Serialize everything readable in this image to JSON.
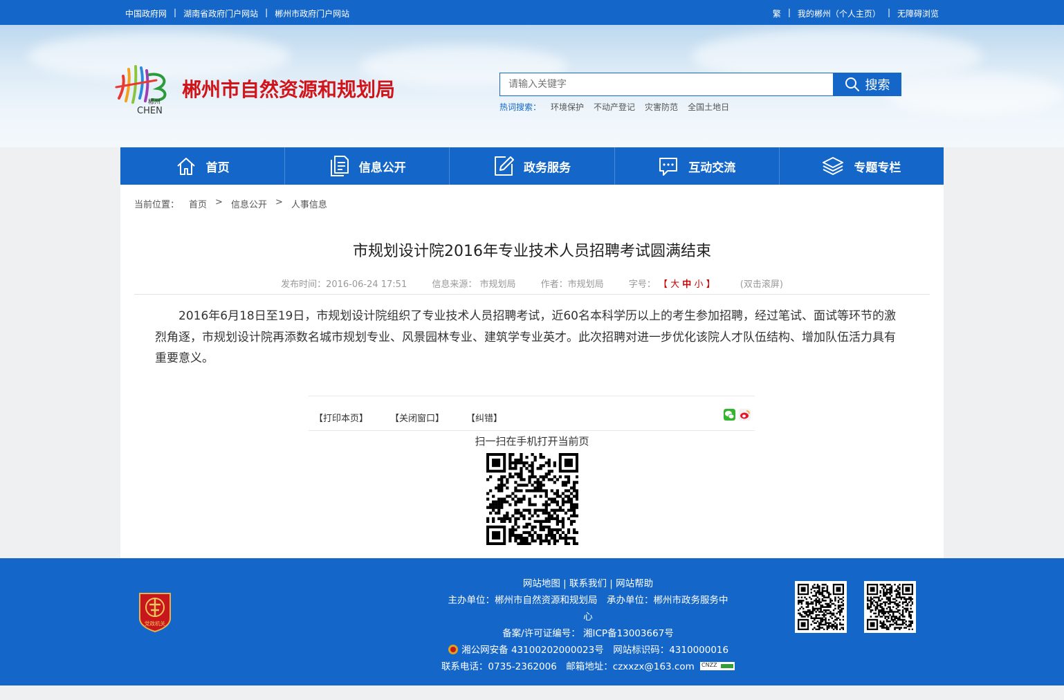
{
  "topbar": {
    "left_links": [
      "中国政府网",
      "湖南省政府门户网站",
      "郴州市政府门户网站"
    ],
    "right_links": [
      "繁",
      "我的郴州（个人主页）",
      "无障碍浏览"
    ]
  },
  "header": {
    "logo_text": "郴州",
    "logo_sub": "CHEN",
    "site_title": "郴州市自然资源和规划局",
    "search_placeholder": "请输入关键字",
    "search_button": "搜索",
    "hot_label": "热词搜索：",
    "hot_words": [
      "环境保护",
      "不动产登记",
      "灾害防范",
      "全国土地日"
    ]
  },
  "nav": {
    "items": [
      {
        "label": "首页",
        "icon": "home-icon"
      },
      {
        "label": "信息公开",
        "icon": "document-icon"
      },
      {
        "label": "政务服务",
        "icon": "edit-icon"
      },
      {
        "label": "互动交流",
        "icon": "chat-icon"
      },
      {
        "label": "专题专栏",
        "icon": "layers-icon"
      }
    ]
  },
  "breadcrumb": {
    "prefix": "当前位置：",
    "items": [
      "首页",
      "信息公开",
      "人事信息"
    ],
    "sep": ">"
  },
  "article": {
    "title": "市规划设计院2016年专业技术人员招聘考试圆满结束",
    "publish_time": "发布时间：2016-06-24 17:51",
    "source": "信息来源： 市规划局",
    "author": "作者：市规划局",
    "font_label": "字号：",
    "font_open": "【",
    "font_large": "大",
    "font_medium": "中",
    "font_small": "小",
    "font_close": "】",
    "dblclick": "(双击滚屏)",
    "body": "2016年6月18日至19日，市规划设计院组织了专业技术人员招聘考试，近60名本科学历以上的考生参加招聘，经过笔试、面试等环节的激烈角逐，市规划设计院再添数名城市规划专业、风景园林专业、建筑学专业英才。此次招聘对进一步优化该院人才队伍结构、增加队伍活力具有重要意义。"
  },
  "tools": {
    "print": "【打印本页】",
    "close": "【关闭窗口】",
    "correct": "【纠错】",
    "scan_text": "扫一扫在手机打开当前页"
  },
  "footer": {
    "links": "网站地图 | 联系我们 | 网站帮助",
    "host": "主办单位：郴州市自然资源和规划局　承办单位：郴州市政务服务中",
    "host_cont": "心",
    "icp": "备案/许可证编号： 湘ICP备13003667号",
    "police": "湘公网安备 43100202000023号　网站标识码：4310000016",
    "contact": "联系电话：0735-2362006　邮箱地址：czxxzx@163.com",
    "badge_text": "党政机关",
    "cnzz": "CNZZ"
  },
  "colors": {
    "primary": "#1466c8",
    "title_red": "#d0141a",
    "font_red": "#cc0000"
  }
}
